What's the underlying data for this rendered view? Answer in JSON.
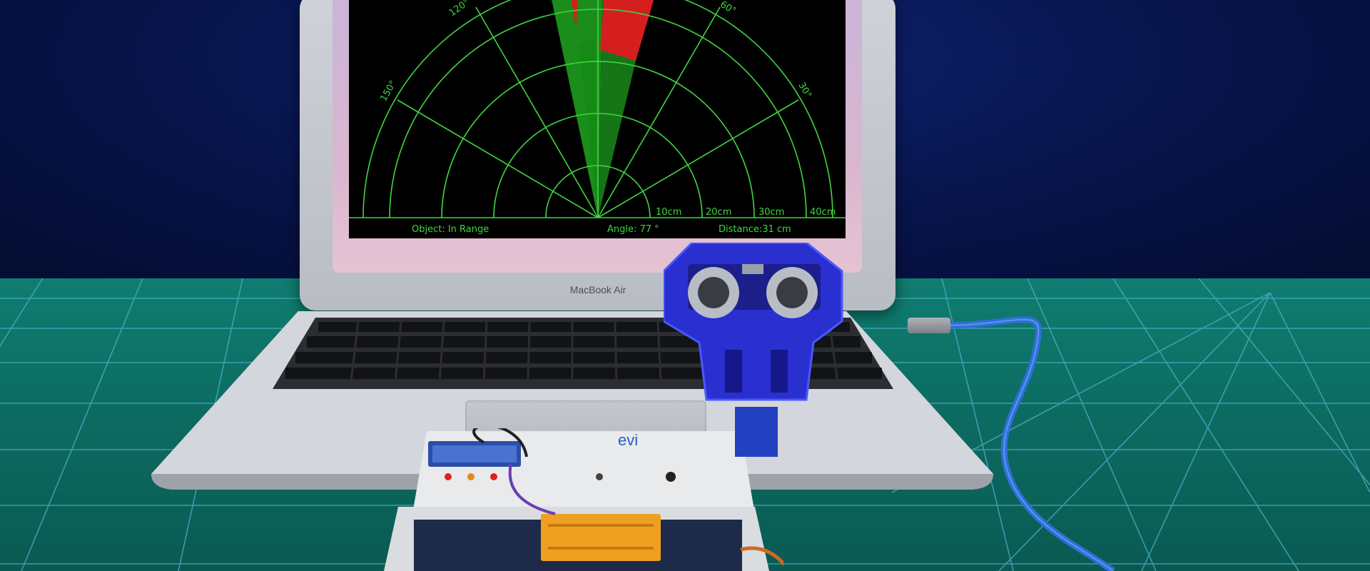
{
  "radar": {
    "angle_labels": [
      "120°",
      "60°",
      "150°",
      "30°"
    ],
    "range_labels": [
      "10cm",
      "20cm",
      "30cm",
      "40cm"
    ],
    "status_object": "Object: In Range",
    "status_angle": "Angle: 77 °",
    "status_distance": "Distance:31   cm"
  },
  "laptop": {
    "brand": "MacBook Air"
  },
  "colors": {
    "radar_line": "#3fd63f",
    "sweep_green": "#1fa61f",
    "sweep_red": "#e02020",
    "mat": "#0f7d70",
    "wall": "#081650",
    "sensor_mount": "#2a2fd0"
  },
  "icons": {
    "radar_display": "radar-display-icon",
    "ultrasonic_sensor": "ultrasonic-sensor-icon"
  },
  "kit_label": "evi"
}
